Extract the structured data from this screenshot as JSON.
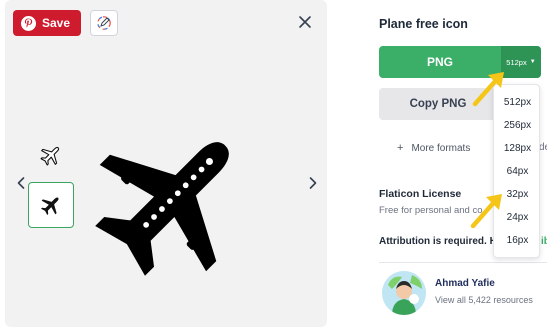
{
  "preview": {
    "save_label": "Save",
    "icons": {
      "pinterest": "pinterest-icon",
      "edit": "edit-pencil-icon",
      "close": "close-icon",
      "prev": "chevron-left-icon",
      "next": "chevron-right-icon",
      "thumb_outline": "plane-outline-icon",
      "thumb_filled": "plane-filled-icon",
      "main": "plane-filled-icon"
    }
  },
  "sidebar": {
    "title": "Plane free icon",
    "png_label": "PNG",
    "size_selected": "512px",
    "copy_label": "Copy PNG",
    "more_formats": "More formats",
    "more_formats_clip": "de",
    "license_title": "Flaticon License",
    "license_desc": "Free for personal and co",
    "attribution": "Attribution is required.",
    "attribution_more": "H",
    "attribution_link": "ib",
    "author": {
      "name": "Ahmad Yafie",
      "meta": "View all 5,422 resources"
    }
  },
  "size_dropdown": {
    "options": [
      "512px",
      "256px",
      "128px",
      "64px",
      "32px",
      "24px",
      "16px"
    ]
  },
  "colors": {
    "save_red": "#cf1b2e",
    "png_green": "#3bae68",
    "size_green": "#2e9456",
    "annotation_yellow": "#f5c518",
    "selected_border": "#3aa55f"
  }
}
